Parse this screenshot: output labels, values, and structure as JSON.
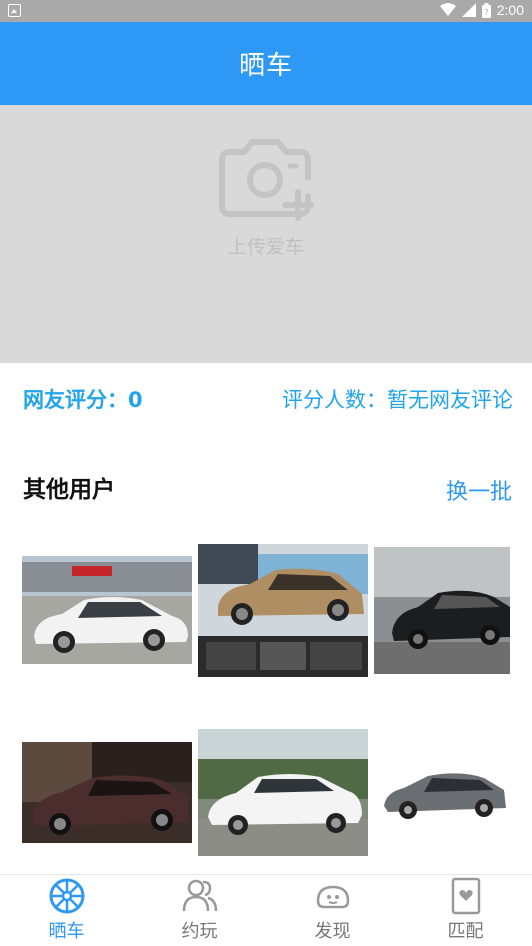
{
  "status_bar": {
    "time": "2:00"
  },
  "header": {
    "title": "晒车"
  },
  "upload": {
    "label": "上传爱车",
    "icon": "camera-plus-icon"
  },
  "rating": {
    "score_text": "网友评分：0",
    "count_text": "评分人数：暂无网友评论"
  },
  "others": {
    "title": "其他用户",
    "refresh_label": "换一批"
  },
  "cars": [
    {
      "name": "white-sedan-photo"
    },
    {
      "name": "gold-sedan-photo"
    },
    {
      "name": "black-sedan-photo"
    },
    {
      "name": "maroon-sedan-photo"
    },
    {
      "name": "white-compact-photo"
    },
    {
      "name": "grey-sedan-photo"
    }
  ],
  "tabs": [
    {
      "label": "晒车",
      "icon": "wheel-icon",
      "active": true
    },
    {
      "label": "约玩",
      "icon": "users-icon",
      "active": false
    },
    {
      "label": "发现",
      "icon": "face-icon",
      "active": false
    },
    {
      "label": "匹配",
      "icon": "card-heart-icon",
      "active": false
    }
  ],
  "colors": {
    "primary": "#2e98f7",
    "accent_text": "#22a4ec",
    "upload_bg": "#d9d9d9",
    "status_bar": "#a9a9a9"
  }
}
